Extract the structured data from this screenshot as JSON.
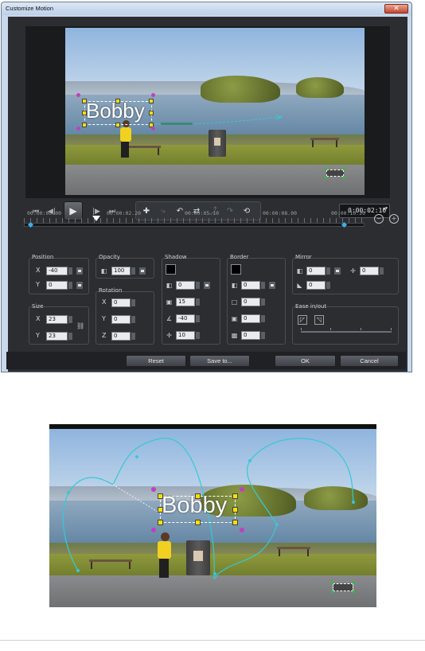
{
  "window": {
    "title": "Customize Motion",
    "close_glyph": "✕"
  },
  "preview": {
    "overlay_text": "Bobby"
  },
  "transport": {
    "buttons": [
      "⏮",
      "◀|",
      "▶",
      "|▶",
      "⏭"
    ],
    "tools": [
      "✚",
      "⤷",
      "↶",
      "⇄",
      "⤴",
      "↷",
      "⟲"
    ],
    "timecode": "0:00:02:10",
    "spin": "▲▼"
  },
  "timeline": {
    "labels": [
      "00:00:00.00",
      "00:00:02.20",
      "00:00:05.10",
      "00:00:08.00",
      "00:00:10.20"
    ],
    "zoom_out": "−",
    "zoom_in": "+"
  },
  "position": {
    "label": "Position",
    "x_label": "X",
    "x": "-40",
    "y_label": "Y",
    "y": "0"
  },
  "opacity": {
    "label": "Opacity",
    "value": "100"
  },
  "size": {
    "label": "Size",
    "x_label": "X",
    "x": "23",
    "y_label": "Y",
    "y": "23"
  },
  "rotation": {
    "label": "Rotation",
    "x_label": "X",
    "x": "0",
    "y_label": "Y",
    "y": "0",
    "z_label": "Z",
    "z": "0"
  },
  "shadow": {
    "label": "Shadow",
    "opacity": "0",
    "blur": "15",
    "direction": "-40",
    "distance": "10",
    "color": "#000000"
  },
  "border": {
    "label": "Border",
    "opacity": "0",
    "width": "0",
    "blur": "0",
    "transparency": "0",
    "color": "#000000"
  },
  "mirror": {
    "label": "Mirror",
    "opacity": "0",
    "distance": "0",
    "fade": "0"
  },
  "ease": {
    "label": "Ease in/out"
  },
  "footer": {
    "reset": "Reset",
    "save_to": "Save to...",
    "ok": "OK",
    "cancel": "Cancel"
  },
  "colors": {
    "client_bg": "#2b2d31",
    "keyframe": "#3fb0e8",
    "motion_path": "#35c9d6",
    "handle": "#ffe000",
    "rotate_handle": "#c040c0"
  }
}
